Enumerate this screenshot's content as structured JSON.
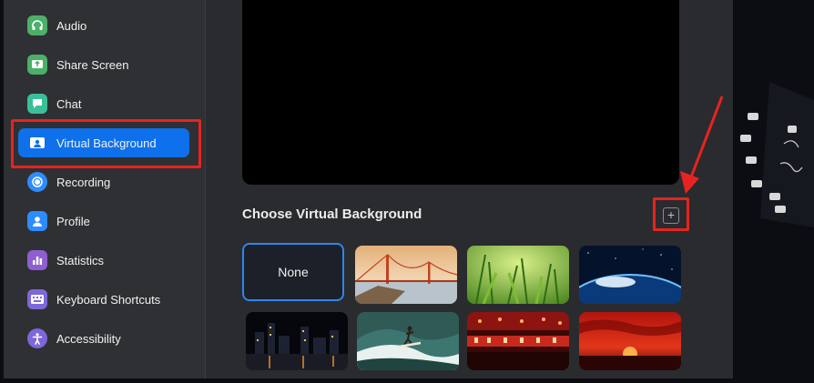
{
  "sidebar": {
    "items": [
      {
        "label": "Audio",
        "icon": "headphones-icon",
        "color": "#4caf6a"
      },
      {
        "label": "Share Screen",
        "icon": "share-screen-icon",
        "color": "#4caf6a"
      },
      {
        "label": "Chat",
        "icon": "chat-bubble-icon",
        "color": "#3bbf9a"
      },
      {
        "label": "Virtual Background",
        "icon": "person-card-icon",
        "color": "#0e71eb",
        "active": true
      },
      {
        "label": "Recording",
        "icon": "record-icon",
        "color": "#2d8cff"
      },
      {
        "label": "Profile",
        "icon": "profile-icon",
        "color": "#2d8cff"
      },
      {
        "label": "Statistics",
        "icon": "bar-chart-icon",
        "color": "#8e5fd1"
      },
      {
        "label": "Keyboard Shortcuts",
        "icon": "keyboard-icon",
        "color": "#7e67d9"
      },
      {
        "label": "Accessibility",
        "icon": "accessibility-icon",
        "color": "#7e67d9"
      }
    ]
  },
  "main": {
    "section_title": "Choose Virtual Background",
    "add_button_symbol": "+",
    "backgrounds": [
      {
        "label": "None",
        "selected": true
      },
      {
        "label": "",
        "scene": "golden-gate-bridge"
      },
      {
        "label": "",
        "scene": "green-grass"
      },
      {
        "label": "",
        "scene": "earth-from-space"
      },
      {
        "label": "",
        "scene": "city-skyline-night"
      },
      {
        "label": "",
        "scene": "surfer-wave"
      },
      {
        "label": "",
        "scene": "red-lounge"
      },
      {
        "label": "",
        "scene": "red-sunset"
      }
    ]
  },
  "annotations": {
    "highlight_color": "#e8231f"
  }
}
